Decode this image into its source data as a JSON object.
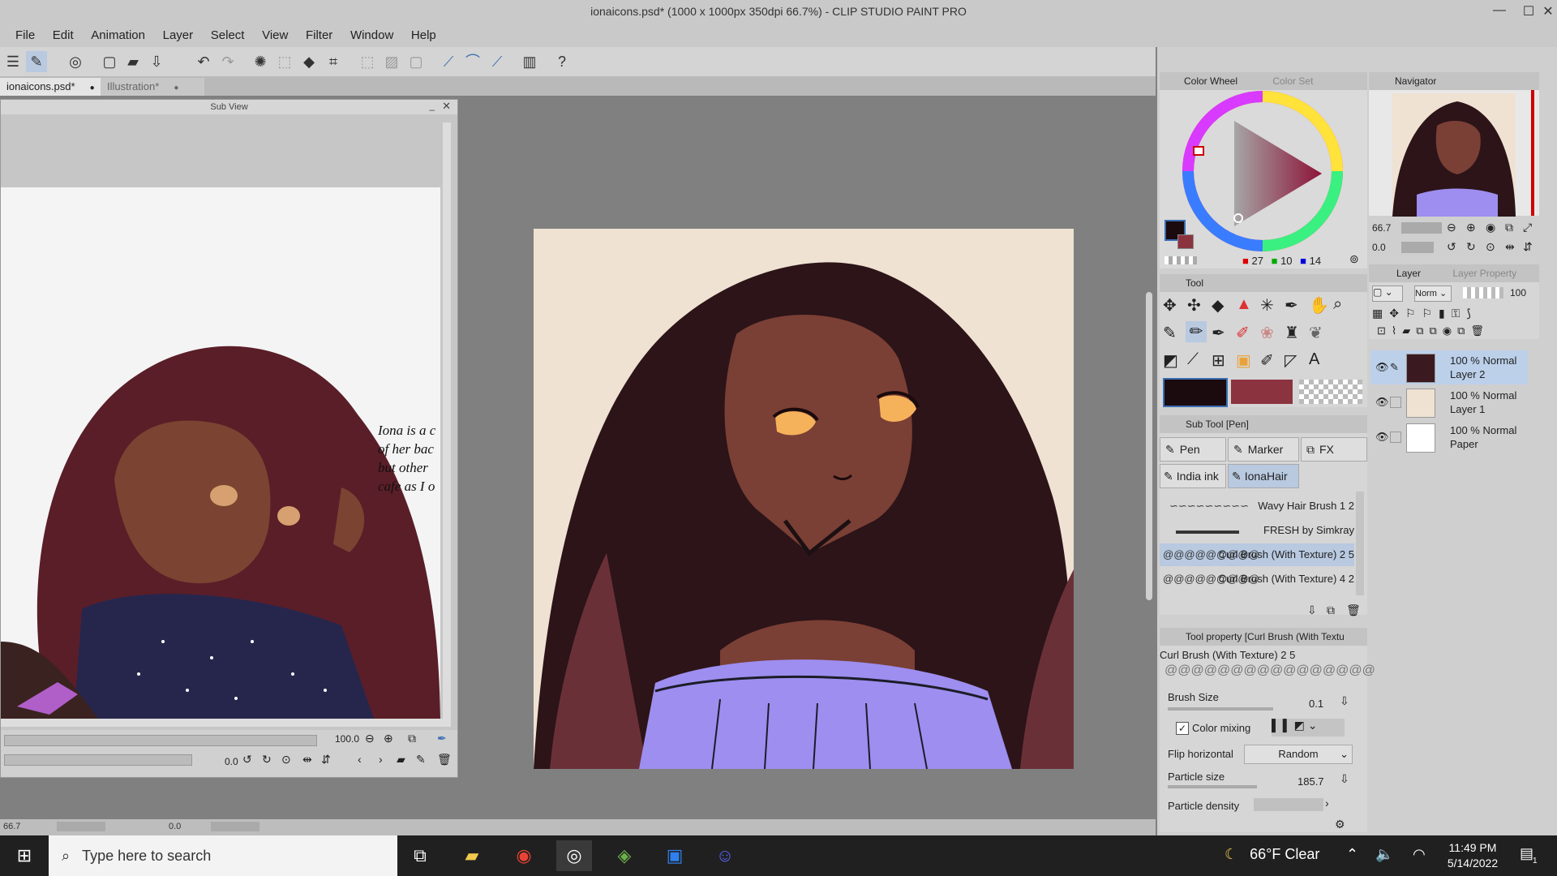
{
  "window": {
    "title": "ionaicons.psd* (1000 x 1000px 350dpi 66.7%) - CLIP STUDIO PAINT PRO",
    "controls": [
      "—",
      "☐",
      "✕"
    ]
  },
  "menu": [
    "File",
    "Edit",
    "Animation",
    "Layer",
    "Select",
    "View",
    "Filter",
    "Window",
    "Help"
  ],
  "tabs": [
    {
      "label": "ionaicons.psd*",
      "active": true
    },
    {
      "label": "Illustration*",
      "active": false
    }
  ],
  "subview": {
    "title": "Sub View",
    "text_lines": [
      "Iona is a c",
      "of her bac",
      "but other",
      "cafe as I o"
    ],
    "zoom": "100.0",
    "rotate": "0.0"
  },
  "status": {
    "zoom": "66.7",
    "rotate": "0.0"
  },
  "color_panel": {
    "tab_active": "Color Wheel",
    "tab_inactive": "Color Set",
    "r": "27",
    "g": "10",
    "b": "14",
    "main_color": "#1b0a0e",
    "sub_color": "#8b3440"
  },
  "navigator": {
    "title": "Navigator",
    "zoom": "66.7",
    "rotate": "0.0"
  },
  "tool_panel": {
    "title": "Tool"
  },
  "subtool_panel": {
    "title": "Sub Tool [Pen]",
    "groups": [
      "Pen",
      "Marker",
      "FX",
      "India ink",
      "IonaHair"
    ],
    "brushes": [
      "Wavy Hair Brush 1 2",
      "FRESH by Simkray",
      "Curl Brush (With Texture) 2 5",
      "Curl Brush (With Texture) 4 2"
    ]
  },
  "tool_property": {
    "title": "Tool property [Curl Brush (With Textu",
    "brush_name": "Curl Brush (With Texture) 2 5",
    "brush_size_label": "Brush Size",
    "brush_size": "0.1",
    "color_mixing_label": "Color mixing",
    "flip_label": "Flip horizontal",
    "flip_value": "Random",
    "particle_size_label": "Particle size",
    "particle_size": "185.7",
    "particle_density_label": "Particle density"
  },
  "layer_panel": {
    "tab_active": "Layer",
    "tab_inactive": "Layer Property",
    "blend": "Norm",
    "opacity": "100",
    "layers": [
      {
        "mode": "100 % Normal",
        "name": "Layer 2",
        "selected": true
      },
      {
        "mode": "100 % Normal",
        "name": "Layer 1",
        "selected": false
      },
      {
        "mode": "100 % Normal",
        "name": "Paper",
        "selected": false
      }
    ]
  },
  "taskbar": {
    "search_placeholder": "Type here to search",
    "weather": "66°F  Clear",
    "time": "11:49 PM",
    "date": "5/14/2022",
    "notification_count": "1"
  }
}
